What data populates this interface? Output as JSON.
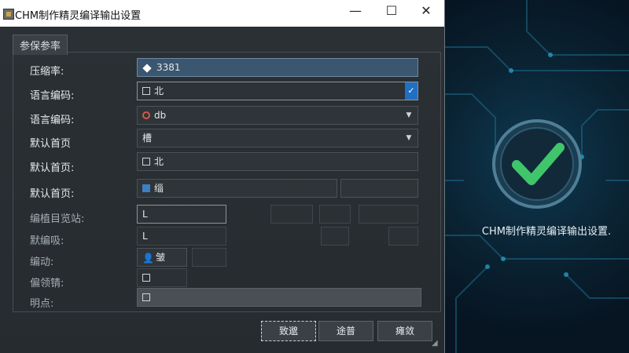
{
  "window": {
    "title": "CHM制作精灵编译输出设置",
    "min_label": "—",
    "max_label": "☐",
    "close_label": "✕"
  },
  "section": {
    "tab_label": "参保参率"
  },
  "rows": {
    "r1": {
      "label": "压缩率:",
      "value": "3381"
    },
    "r2": {
      "label": "语言编码:",
      "value": "北"
    },
    "r3": {
      "label": "语言编码:",
      "value": "db"
    },
    "r4": {
      "label": "默认首页",
      "value": "槽"
    },
    "r5": {
      "label": "默认首页:",
      "value": "北"
    },
    "r6": {
      "label": "默认首页:",
      "value": "缁"
    },
    "r7": {
      "label": "编植目览站:",
      "value": "L"
    },
    "r8": {
      "label": "默编吸:",
      "value": "L"
    },
    "r9": {
      "label": "编动:",
      "value": "皱"
    },
    "r10": {
      "label": "偏领锖:",
      "value": ""
    },
    "r11": {
      "label": "明点:",
      "value": ""
    }
  },
  "buttons": {
    "ok": "致邈",
    "apply": "途普",
    "cancel": "瘫敛"
  },
  "side": {
    "caption": "CHM制作精灵编译输出设置."
  },
  "colors": {
    "accent": "#1f6fc2",
    "check_green": "#3fc66a",
    "panel_bg": "#0a2333"
  },
  "icons": {
    "check": "checkmark-badge-icon",
    "dropdown": "chevron-down-icon"
  }
}
